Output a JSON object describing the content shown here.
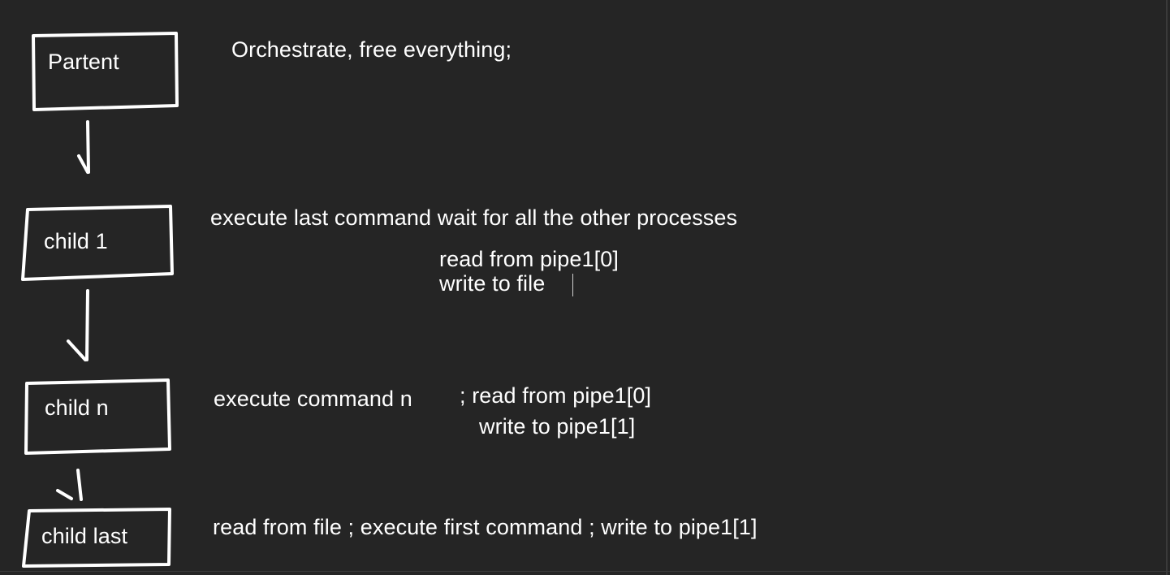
{
  "nodes": {
    "parent": "Partent",
    "child_1": "child 1",
    "child_n": "child n",
    "child_last": "child last"
  },
  "notes": {
    "parent": "Orchestrate, free everything;",
    "child_1": "execute last command wait for all the other processes",
    "child_1_read": "read from pipe1[0]",
    "child_1_write": "write to file",
    "child_n": "execute command n",
    "child_n_read": "; read from pipe1[0]",
    "child_n_write": "write to pipe1[1]",
    "child_last": "read from file ; execute first command ; write to pipe1[1]"
  },
  "colors": {
    "background": "#252525",
    "ink": "#ffffff"
  }
}
